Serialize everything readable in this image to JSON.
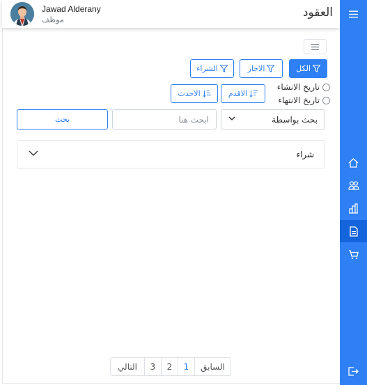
{
  "header": {
    "title": "العقود",
    "user_name": "Jawad Alderany",
    "user_role": "موظف"
  },
  "filters": {
    "all_label": "الكل",
    "rent_label": "الاجار",
    "buy_label": "الشراء"
  },
  "sort": {
    "oldest_label": "الاقدم",
    "newest_label": "الاحدث"
  },
  "date_options": {
    "created": "تاريخ الانشاء",
    "expiry": "تاريخ الانتهاء"
  },
  "search": {
    "by_label": "بحث بواسطة",
    "placeholder": "ابحث هنا",
    "button_label": "بحث"
  },
  "results": [
    {
      "label": "شراء"
    }
  ],
  "pagination": {
    "prev": "السابق",
    "pages": [
      "1",
      "2",
      "3"
    ],
    "next": "التالي",
    "active_page": "1"
  },
  "sidebar": {
    "items": [
      "menu-icon",
      "home-icon",
      "users-icon",
      "buildings-icon",
      "contracts-icon",
      "cart-icon",
      "logout-icon"
    ],
    "active": "contracts-icon"
  },
  "colors": {
    "accent": "#2f80f5",
    "accent_active": "#1464dc"
  }
}
